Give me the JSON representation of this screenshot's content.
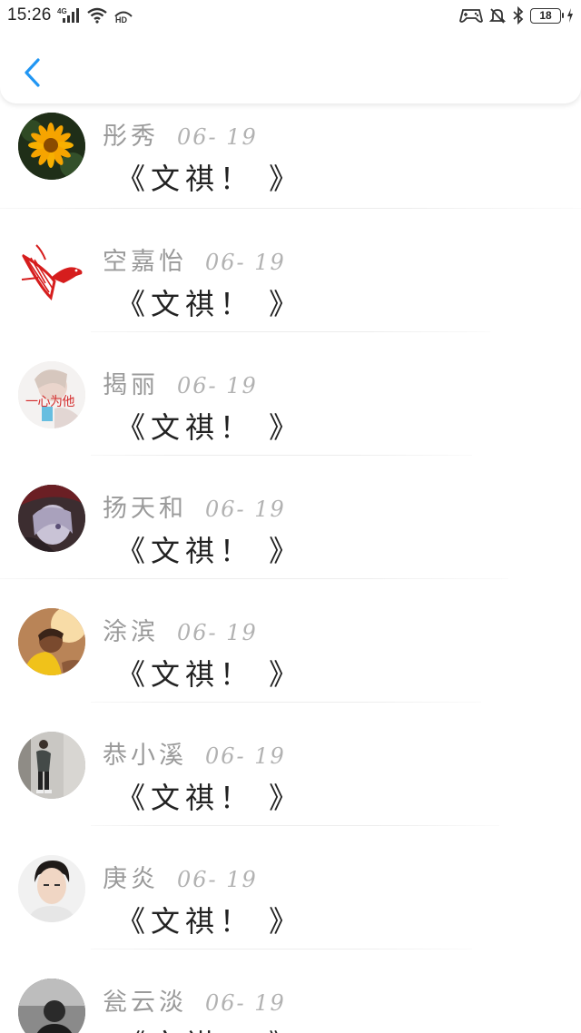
{
  "status_bar": {
    "time": "15:26",
    "network": "4G",
    "hd": "HD",
    "battery": "18",
    "icons": [
      "signal-icon",
      "wifi-icon",
      "hd-icon",
      "gamepad-icon",
      "bell-mute-icon",
      "bluetooth-icon",
      "battery-icon",
      "charging-icon"
    ]
  },
  "header": {
    "back_icon": "chevron-left-icon",
    "accent_color": "#2196f3"
  },
  "messages": [
    {
      "name": "彤秀",
      "date": "06- 19",
      "text": "《文祺！ 》",
      "avatar": "sunflower"
    },
    {
      "name": "空嘉怡",
      "date": "06- 19",
      "text": "《文祺！ 》",
      "avatar": "red-bird"
    },
    {
      "name": "揭丽",
      "date": "06- 19",
      "text": "《文祺！ 》",
      "avatar": "girl-with-text",
      "avatar_text": "一心为他"
    },
    {
      "name": "扬天和",
      "date": "06- 19",
      "text": "《文祺！ 》",
      "avatar": "anime-character"
    },
    {
      "name": "涂滨",
      "date": "06- 19",
      "text": "《文祺！ 》",
      "avatar": "boy-sunset"
    },
    {
      "name": "恭小溪",
      "date": "06- 19",
      "text": "《文祺！ 》",
      "avatar": "man-standing"
    },
    {
      "name": "庚炎",
      "date": "06- 19",
      "text": "《文祺！ 》",
      "avatar": "young-man-portrait"
    },
    {
      "name": "瓮云淡",
      "date": "06- 19",
      "text": "《文祺！ 》",
      "avatar": "dark-silhouette"
    }
  ]
}
